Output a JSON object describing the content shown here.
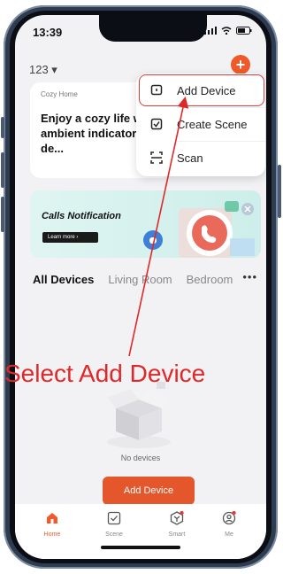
{
  "status_bar": {
    "time": "13:39"
  },
  "header": {
    "home_name": "123 ▾"
  },
  "card": {
    "label": "Cozy Home",
    "text": "Enjoy a cozy life with ambient indicators and de..."
  },
  "menu": {
    "items": [
      {
        "label": "Add Device",
        "icon": "add-device-icon"
      },
      {
        "label": "Create Scene",
        "icon": "create-scene-icon"
      },
      {
        "label": "Scan",
        "icon": "scan-icon"
      }
    ]
  },
  "banner": {
    "title": "Calls Notification",
    "button": "Learn more ›"
  },
  "tabs": [
    {
      "label": "All Devices"
    },
    {
      "label": "Living Room"
    },
    {
      "label": "Bedroom"
    }
  ],
  "more_label": "•••",
  "annotation": "Select Add Device",
  "empty": {
    "message": "No devices",
    "button": "Add Device"
  },
  "tabbar": [
    {
      "label": "Home"
    },
    {
      "label": "Scene"
    },
    {
      "label": "Smart"
    },
    {
      "label": "Me"
    }
  ],
  "colors": {
    "accent": "#f05a2a",
    "annotation": "#e02828"
  }
}
